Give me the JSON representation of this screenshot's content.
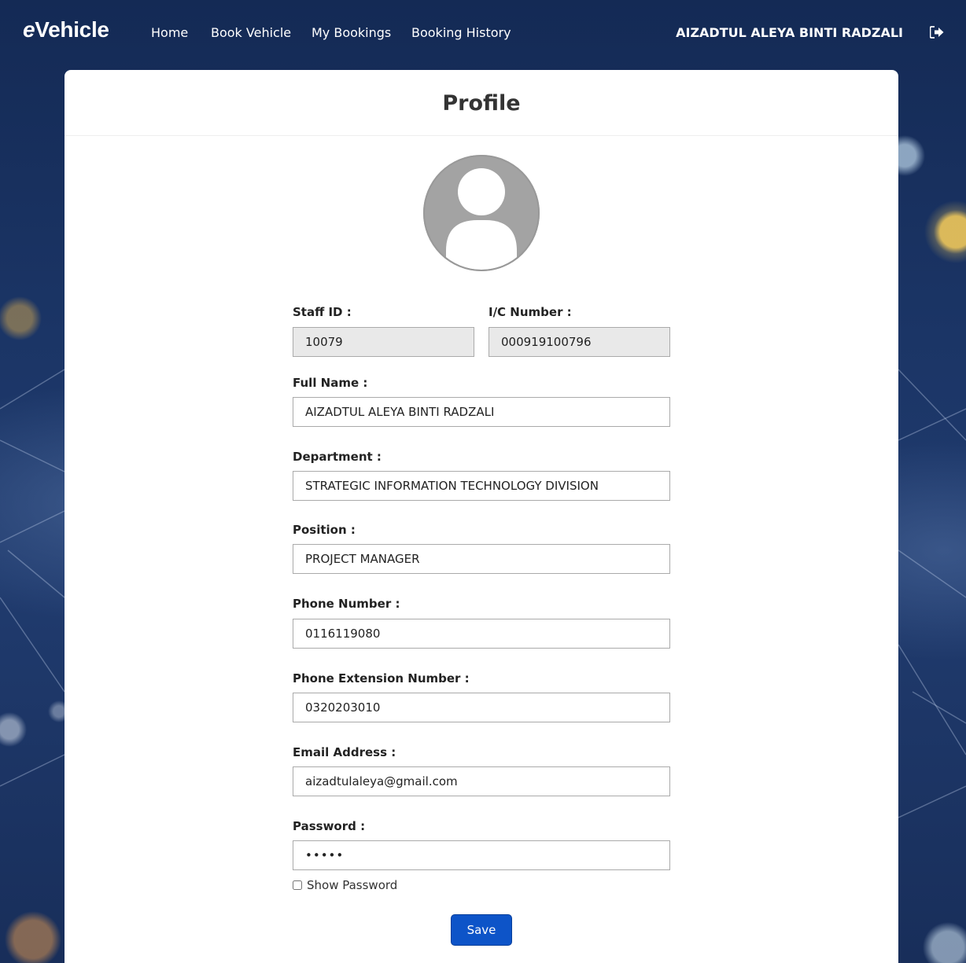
{
  "brand": {
    "prefix": "e",
    "name": "Vehicle"
  },
  "nav": {
    "home": "Home",
    "book_vehicle": "Book Vehicle",
    "my_bookings": "My Bookings",
    "booking_history": "Booking History"
  },
  "user": {
    "name": "AIZADTUL ALEYA BINTI RADZALI",
    "logout_icon": "sign-out-icon"
  },
  "page": {
    "title": "Profile",
    "avatar_icon": "user-avatar-icon"
  },
  "form": {
    "staff_id": {
      "label": "Staff ID :",
      "value": "10079"
    },
    "ic_number": {
      "label": "I/C Number :",
      "value": "000919100796"
    },
    "full_name": {
      "label": "Full Name :",
      "value": "AIZADTUL ALEYA BINTI RADZALI"
    },
    "department": {
      "label": "Department :",
      "value": "STRATEGIC INFORMATION TECHNOLOGY DIVISION"
    },
    "position": {
      "label": "Position :",
      "value": "PROJECT MANAGER"
    },
    "phone": {
      "label": "Phone Number :",
      "value": "0116119080"
    },
    "phone_ext": {
      "label": "Phone Extension Number :",
      "value": "0320203010"
    },
    "email": {
      "label": "Email Address :",
      "value": "aizadtulaleya@gmail.com"
    },
    "password": {
      "label": "Password :",
      "value": "•••••"
    },
    "show_password": {
      "label": "Show Password",
      "checked": false
    },
    "save_label": "Save"
  },
  "colors": {
    "nav_bg": "#1b3566",
    "save_button": "#0d54c8",
    "readonly_field": "#e9e9e9"
  }
}
